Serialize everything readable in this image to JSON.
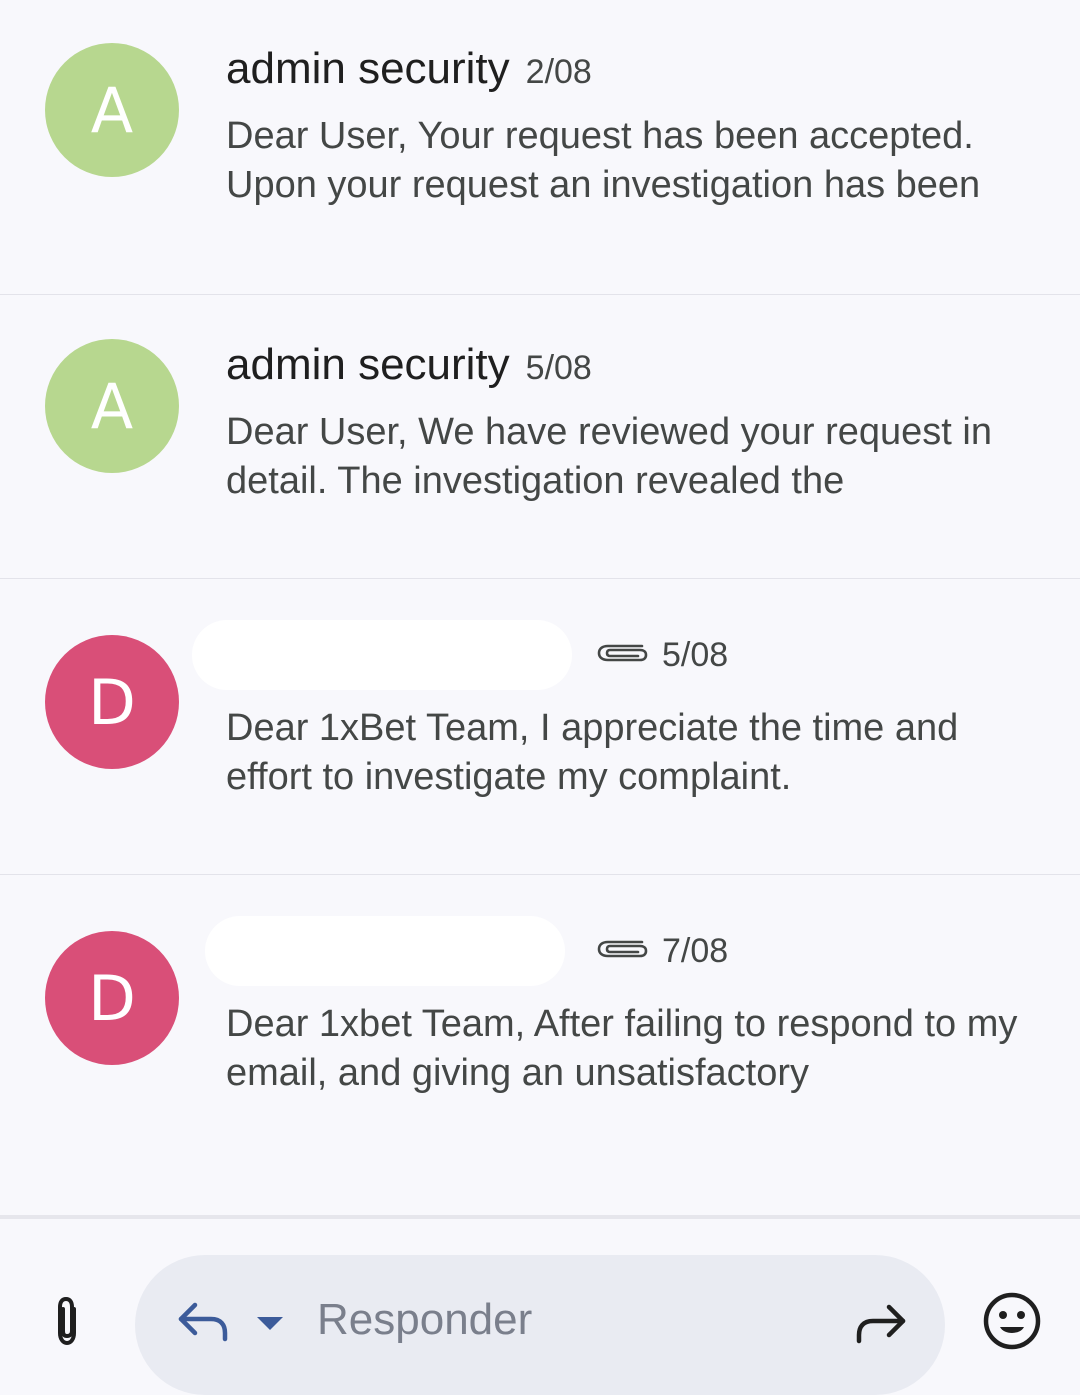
{
  "messages": [
    {
      "avatar_letter": "A",
      "avatar_color": "#b7d78f",
      "sender": "admin security",
      "date": "2/08",
      "has_attachment": false,
      "snippet": "Dear User, Your request has been accepted. Upon your request an investigation has been"
    },
    {
      "avatar_letter": "A",
      "avatar_color": "#b7d78f",
      "sender": "admin security",
      "date": "5/08",
      "has_attachment": false,
      "snippet": "Dear User, We have reviewed your request in detail. The investigation revealed the"
    },
    {
      "avatar_letter": "D",
      "avatar_color": "#d94f78",
      "sender": "",
      "date": "5/08",
      "has_attachment": true,
      "snippet": "Dear 1xBet Team, I appreciate the time and effort to investigate my complaint."
    },
    {
      "avatar_letter": "D",
      "avatar_color": "#d94f78",
      "sender": "",
      "date": "7/08",
      "has_attachment": true,
      "snippet": "Dear 1xbet Team, After failing to respond to my email, and giving an unsatisfactory"
    }
  ],
  "reply_bar": {
    "placeholder": "Responder",
    "attach_icon": "paperclip-icon",
    "reply_icon": "reply-icon",
    "forward_icon": "forward-icon",
    "emoji_icon": "emoji-icon"
  }
}
